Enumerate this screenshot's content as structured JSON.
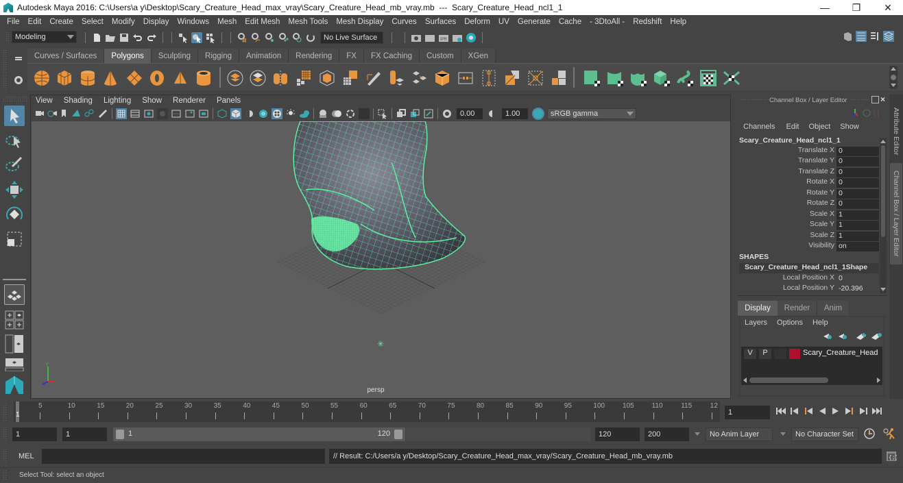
{
  "window": {
    "title": "Autodesk Maya 2016: C:\\Users\\a y\\Desktop\\Scary_Creature_Head_max_vray\\Scary_Creature_Head_mb_vray.mb  ---  Scary_Creature_Head_ncl1_1",
    "minimize": "—",
    "maximize": "❐",
    "close": "✕"
  },
  "menubar": [
    "File",
    "Edit",
    "Create",
    "Select",
    "Modify",
    "Display",
    "Windows",
    "Mesh",
    "Edit Mesh",
    "Mesh Tools",
    "Mesh Display",
    "Curves",
    "Surfaces",
    "Deform",
    "UV",
    "Generate",
    "Cache",
    "- 3DtoAll -",
    "Redshift",
    "Help"
  ],
  "statusline": {
    "mode": "Modeling",
    "live_surface": "No Live Surface"
  },
  "shelf": {
    "tabs": [
      "Curves / Surfaces",
      "Polygons",
      "Sculpting",
      "Rigging",
      "Animation",
      "Rendering",
      "FX",
      "FX Caching",
      "Custom",
      "XGen"
    ],
    "active_tab": "Polygons",
    "icons": [
      "poly-sphere-icon",
      "poly-cube-icon",
      "poly-cylinder-icon",
      "poly-cone-icon",
      "poly-plane-icon",
      "poly-torus-icon",
      "poly-pyramid-icon",
      "poly-pipe-icon",
      "combine-icon",
      "separate-icon",
      "smooth-icon",
      "bevel-icon",
      "extrude-icon",
      "bridge-icon",
      "multi-cut-icon",
      "target-weld-icon",
      "append-icon",
      "bridge-edge-icon",
      "fill-hole-icon",
      "duplicate-face-icon",
      "mirror-icon",
      "boolean-icon",
      "merge-vertex-icon",
      "quad-draw-icon",
      "planar-uv-icon",
      "cylindrical-uv-icon",
      "spherical-uv-icon",
      "automatic-uv-icon",
      "unfold-uv-icon",
      "uv-editor-icon",
      "uv-layout-icon"
    ]
  },
  "panel": {
    "menus": [
      "View",
      "Shading",
      "Lighting",
      "Show",
      "Renderer",
      "Panels"
    ],
    "exposure": "0.00",
    "gamma": "1.00",
    "color_space": "sRGB gamma",
    "camera_label": "persp"
  },
  "channel_box": {
    "header": "Channel Box / Layer Editor",
    "menus": [
      "Channels",
      "Edit",
      "Object",
      "Show"
    ],
    "object_name": "Scary_Creature_Head_ncl1_1",
    "channels": [
      {
        "name": "Translate X",
        "value": "0"
      },
      {
        "name": "Translate Y",
        "value": "0"
      },
      {
        "name": "Translate Z",
        "value": "0"
      },
      {
        "name": "Rotate X",
        "value": "0"
      },
      {
        "name": "Rotate Y",
        "value": "0"
      },
      {
        "name": "Rotate Z",
        "value": "0"
      },
      {
        "name": "Scale X",
        "value": "1"
      },
      {
        "name": "Scale Y",
        "value": "1"
      },
      {
        "name": "Scale Z",
        "value": "1"
      },
      {
        "name": "Visibility",
        "value": "on"
      }
    ],
    "shapes_label": "SHAPES",
    "shape_name": "Scary_Creature_Head_ncl1_1Shape",
    "shape_channels": [
      {
        "name": "Local Position X",
        "value": "0"
      },
      {
        "name": "Local Position Y",
        "value": "-20.396"
      }
    ]
  },
  "layer_editor": {
    "tabs": [
      "Display",
      "Render",
      "Anim"
    ],
    "active_tab": "Display",
    "menus": [
      "Layers",
      "Options",
      "Help"
    ],
    "layers": [
      {
        "v": "V",
        "p": "P",
        "name": "Scary_Creature_Head",
        "color": "#b0102c"
      }
    ]
  },
  "side_tabs": [
    "Attribute Editor",
    "Channel Box / Layer Editor"
  ],
  "timeline": {
    "ticks": [
      "5",
      "10",
      "15",
      "20",
      "25",
      "30",
      "35",
      "40",
      "45",
      "50",
      "55",
      "60",
      "65",
      "70",
      "75",
      "80",
      "85",
      "90",
      "95",
      "100",
      "105",
      "110",
      "115",
      "12"
    ],
    "current_frame_marker": "1",
    "current_frame": "1"
  },
  "range": {
    "start": "1",
    "playback_start": "1",
    "slider_start": "1",
    "slider_end": "120",
    "playback_end": "120",
    "end": "200",
    "anim_layer": "No Anim Layer",
    "character_set": "No Character Set"
  },
  "command_line": {
    "label": "MEL",
    "input": "",
    "result": "// Result: C:/Users/a y/Desktop/Scary_Creature_Head_max_vray/Scary_Creature_Head_mb_vray.mb"
  },
  "help_line": "Select Tool: select an object",
  "colors": {
    "accent_blue": "#5285a6",
    "wireframe": "#5af0a0",
    "shelf_orange": "#e8953f",
    "shelf_green": "#5dbf91"
  }
}
